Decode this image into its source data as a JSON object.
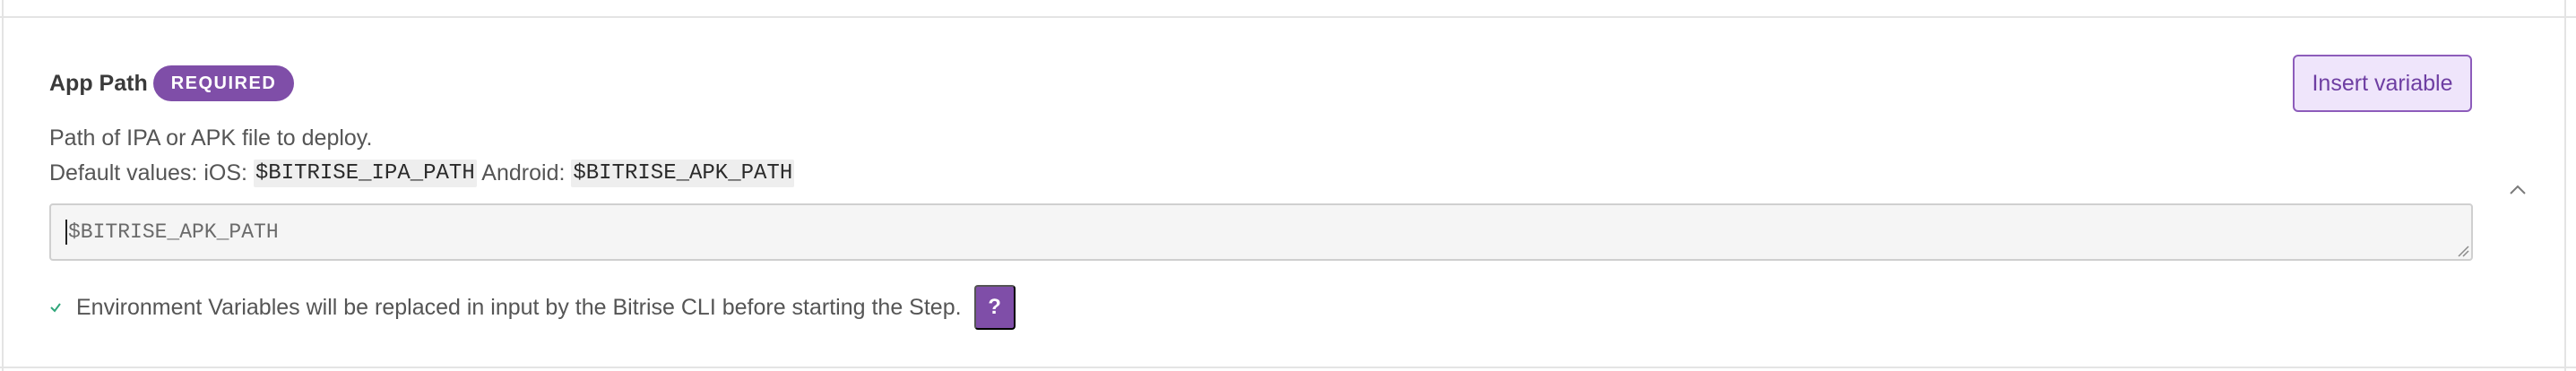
{
  "field": {
    "label": "App Path",
    "badge": "REQUIRED",
    "insert_variable_label": "Insert variable",
    "description": "Path of IPA or APK file to deploy.",
    "defaults": {
      "prefix": "Default values: iOS: ",
      "ios_value": "$BITRISE_IPA_PATH",
      "android_label": " Android: ",
      "android_value": "$BITRISE_APK_PATH"
    },
    "input_value": "$BITRISE_APK_PATH",
    "env_note": "Environment Variables will be replaced in input by the Bitrise CLI before starting the Step.",
    "help_label": "?"
  },
  "icons": {
    "collapse": "chevron-up-icon",
    "note": "check-icon",
    "resize": "resize-handle-icon"
  },
  "colors": {
    "accent": "#7f4ea8",
    "accent_light": "#efe5fb",
    "check": "#2fa67a"
  }
}
